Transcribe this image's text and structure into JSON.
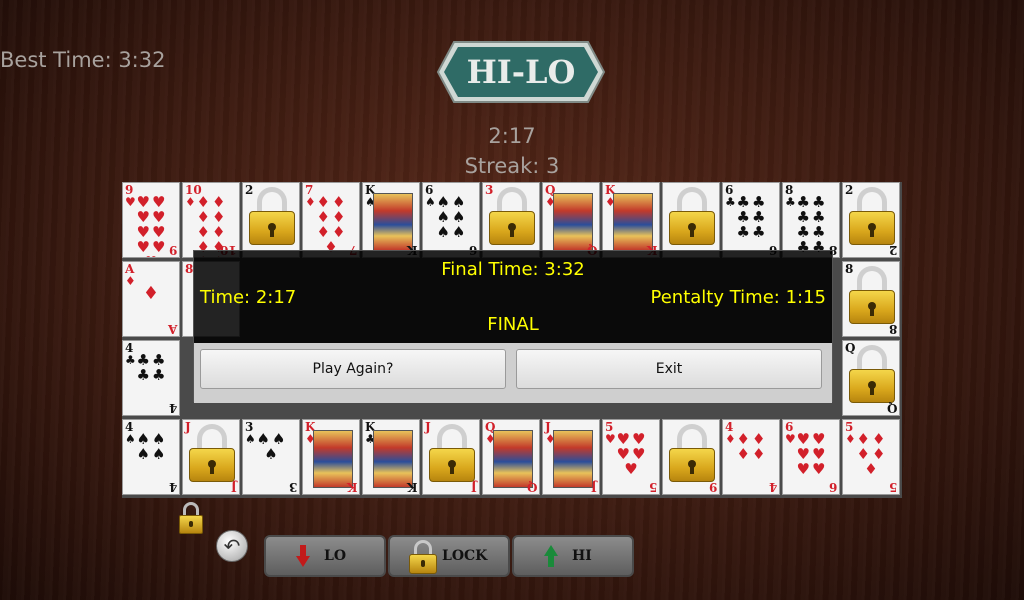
{
  "header": {
    "best_time": "Best Time: 3:32",
    "logo_text": "HI-LO",
    "timer": "2:17",
    "streak": "Streak: 3"
  },
  "board": {
    "rows": [
      [
        "9♥",
        "10♦",
        "locked",
        "7♦",
        "K♠",
        "6♠",
        "locked",
        "Q♦",
        "K♦",
        "locked",
        "6♣",
        "8♣",
        "locked"
      ],
      [
        "A♦",
        "locked",
        "",
        "",
        "",
        "",
        "",
        "",
        "",
        "",
        "",
        "",
        "locked"
      ],
      [
        "4♣",
        "",
        "",
        "",
        "",
        "",
        "",
        "",
        "",
        "",
        "",
        "",
        "locked"
      ],
      [
        "4♠",
        "locked",
        "3♠",
        "K♦",
        "K♣",
        "locked",
        "Q♦",
        "J♦",
        "5♥",
        "locked",
        "4♦",
        "6♥",
        "5♦"
      ]
    ]
  },
  "dialog": {
    "final_time": "Final Time: 3:32",
    "time": "Time: 2:17",
    "penalty_time": "Pentalty Time: 1:15",
    "status": "FINAL",
    "play_again": "Play Again?",
    "exit": "Exit"
  },
  "controls": {
    "lo": "LO",
    "lock": "LOCK",
    "hi": "HI"
  },
  "colors": {
    "dialog_text": "#ffff00",
    "lo_arrow": "#c21a1a",
    "hi_arrow": "#1a8a3a"
  }
}
